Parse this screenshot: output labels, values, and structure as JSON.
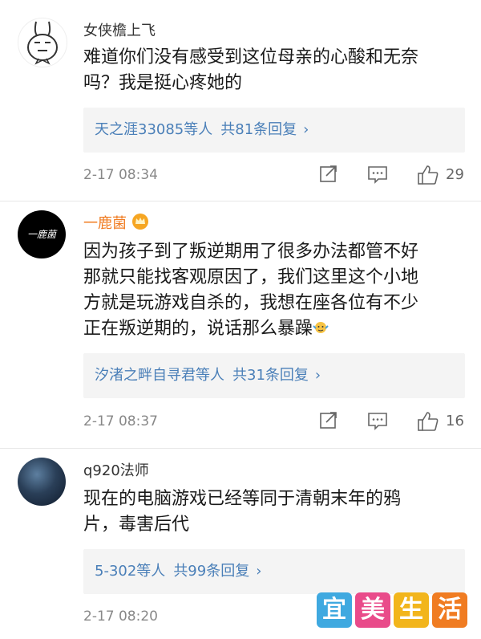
{
  "comments": [
    {
      "username": "女侠檐上飞",
      "text_lines": [
        "难道你们没有感受到这位母亲的心酸和无奈",
        "吗？我是挺心疼她的"
      ],
      "replies": {
        "names": "天之涯33085等人",
        "count": "共81条回复",
        "chevron": "›"
      },
      "time": "2-17 08:34",
      "likes": "29"
    },
    {
      "username": "一鹿菌",
      "avatar_text": "一鹿菌",
      "text_lines": [
        "因为孩子到了叛逆期用了很多办法都管不好",
        "那就只能找客观原因了，我们这里这个小地",
        "方就是玩游戏自杀的，我想在座各位有不少",
        "正在叛逆期的，说话那么暴躁"
      ],
      "replies": {
        "names": "汐渚之畔自寻君等人",
        "count": "共31条回复",
        "chevron": "›"
      },
      "time": "2-17 08:37",
      "likes": "16"
    },
    {
      "username": "q920法师",
      "text_lines": [
        "现在的电脑游戏已经等同于清朝末年的鸦",
        "片，毒害后代"
      ],
      "replies": {
        "names": "5-302等人",
        "count": "共99条回复",
        "chevron": "›"
      },
      "time": "2-17 08:20",
      "likes": ""
    }
  ],
  "watermark": {
    "chars": [
      "宜",
      "美",
      "生",
      "活"
    ],
    "colors": [
      "#3fa9e0",
      "#e94b8a",
      "#f2b51c",
      "#f07c22"
    ]
  },
  "icons": {
    "share": "share-icon",
    "comment": "comment-icon",
    "like": "thumbs-up-icon",
    "crown": "crown-icon"
  }
}
